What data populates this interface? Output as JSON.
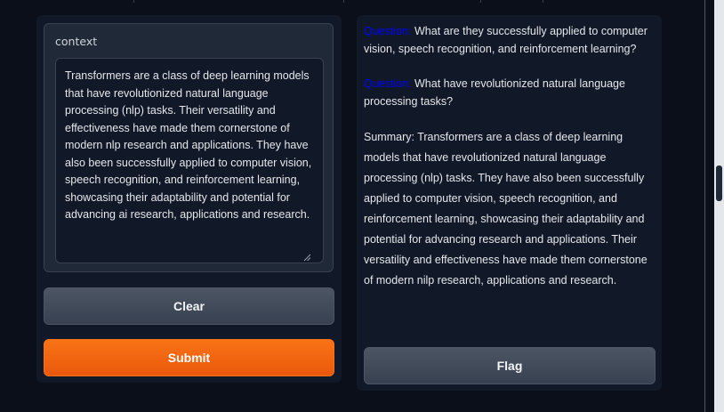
{
  "input": {
    "context_label": "context",
    "context_text": "Transformers are a class of deep learning models that have revolutionized natural language processing (nlp) tasks. Their versatility and effectiveness have made them cornerstone of modern nlp research and applications. They have also been successfully applied to computer vision, speech recognition, and reinforcement learning, showcasing their adaptability and potential for advancing ai research, applications and research."
  },
  "actions": {
    "clear_label": "Clear",
    "submit_label": "Submit",
    "flag_label": "Flag"
  },
  "output": {
    "questions": [
      {
        "prefix": "Question:",
        "text": " What are they successfully applied to computer vision, speech recognition, and reinforcement learning?"
      },
      {
        "prefix": "Question:",
        "text": " What have revolutionized natural language processing tasks?"
      }
    ],
    "summary": "Summary: Transformers are a class of deep learning models that have revolutionized natural language processing (nlp) tasks. They have also been successfully applied to computer vision, speech recognition, and reinforcement learning, showcasing their adaptability and potential for advancing research and applications. Their versatility and effectiveness have made them cornerstone of modern nilp research, applications and research."
  },
  "colors": {
    "background": "#0b0f19",
    "panel": "#111827",
    "accent_orange": "#f97316",
    "question_label": "#0000ff"
  }
}
